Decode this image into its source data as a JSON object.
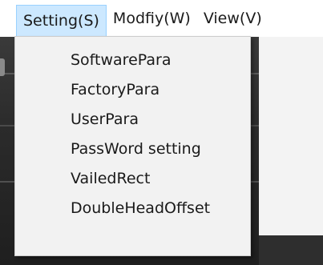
{
  "menubar": {
    "items": [
      {
        "label": "Setting(S)",
        "active": true
      },
      {
        "label": "Modfiy(W)",
        "active": false
      },
      {
        "label": "View(V)",
        "active": false
      }
    ]
  },
  "dropdown": {
    "items": [
      {
        "label": "SoftwarePara"
      },
      {
        "label": "FactoryPara"
      },
      {
        "label": "UserPara"
      },
      {
        "label": "PassWord setting"
      },
      {
        "label": "VailedRect"
      },
      {
        "label": "DoubleHeadOffset"
      }
    ]
  },
  "colors": {
    "active_menu_bg": "#cce8ff",
    "active_menu_border": "#99d1ff",
    "dropdown_bg": "#f2f2f2",
    "text": "#1a1a1a"
  }
}
